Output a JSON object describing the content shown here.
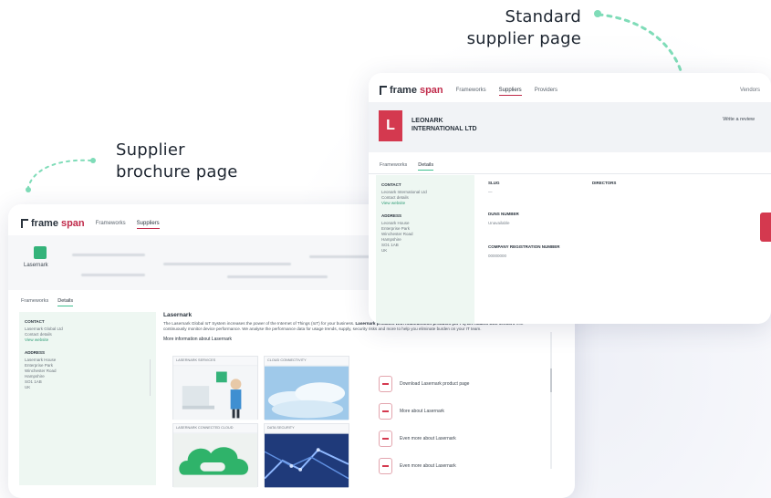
{
  "callouts": {
    "standard_line1": "Standard",
    "standard_line2": "supplier page",
    "brochure_line1": "Supplier",
    "brochure_line2": "brochure page"
  },
  "colors": {
    "callout_dots": "#7fdcb8",
    "accent_red": "#d4394f",
    "accent_green": "#34b37a"
  },
  "standard_page": {
    "logo_text": "frame",
    "logo_text_suffix": "span",
    "nav": [
      "Frameworks",
      "Suppliers",
      "Providers"
    ],
    "top_right": "Vendors",
    "company_line1": "LEONARK",
    "company_line2": "INTERNATIONAL LTD",
    "write_review": "Write a review",
    "tabs": [
      "Frameworks",
      "Details"
    ],
    "side": {
      "heading1": "CONTACT",
      "lines1": [
        "Leonark International Ltd",
        "Contact details"
      ],
      "link1": "View website",
      "heading2": "ADDRESS",
      "lines2": [
        "Leonark House",
        "Enterprise Park",
        "Winchester Road",
        "Hampshire",
        "SO1 1AB",
        "UK"
      ]
    },
    "fields": [
      {
        "key": "SLUG",
        "value": "—"
      },
      {
        "key": "DUNS NUMBER",
        "value": "Unavailable"
      },
      {
        "key": "COMPANY REGISTRATION NUMBER",
        "value": "00000000"
      }
    ],
    "fields_right": {
      "key": "DIRECTORS",
      "value": ""
    }
  },
  "brochure_page": {
    "logo_text": "frame",
    "logo_text_suffix": "span",
    "nav": [
      "Frameworks",
      "Suppliers"
    ],
    "brand_word": "Lasernark",
    "tabs": [
      "Frameworks",
      "Details"
    ],
    "side": {
      "heading1": "CONTACT",
      "lines1": [
        "Lasernark Global Ltd",
        "Contact details"
      ],
      "link1": "View website",
      "heading2": "ADDRESS",
      "lines2": [
        "Lasernark House",
        "Enterprise Park",
        "Winchester Road",
        "Hampshire",
        "SO1 1AB",
        "UK"
      ]
    },
    "title": "Lasernark",
    "para_lead": "The Lasernark Global IoT System increases the power of the Internet of Things (IoT) for your business.",
    "para_bold": "Lasernark products with multifunction products (MFPs) are loaded with sensors",
    "para_tail": "that continuously monitor device performance. We analyse the performance data for usage trends, supply, security risks and more to help you eliminate burden on your IT team.",
    "more_info": "More information about Lasernark",
    "tiles": [
      {
        "caption": "LASERNARK SERVICES"
      },
      {
        "caption": "CLOUD CONNECTIVITY"
      },
      {
        "caption": "LASERNARK CONNECTED CLOUD"
      },
      {
        "caption": "DATA SECURITY"
      }
    ],
    "resources": [
      "Download Lasernark product page",
      "More about Lasernark",
      "Even more about Lasernark",
      "Even more about Lasernark"
    ]
  }
}
